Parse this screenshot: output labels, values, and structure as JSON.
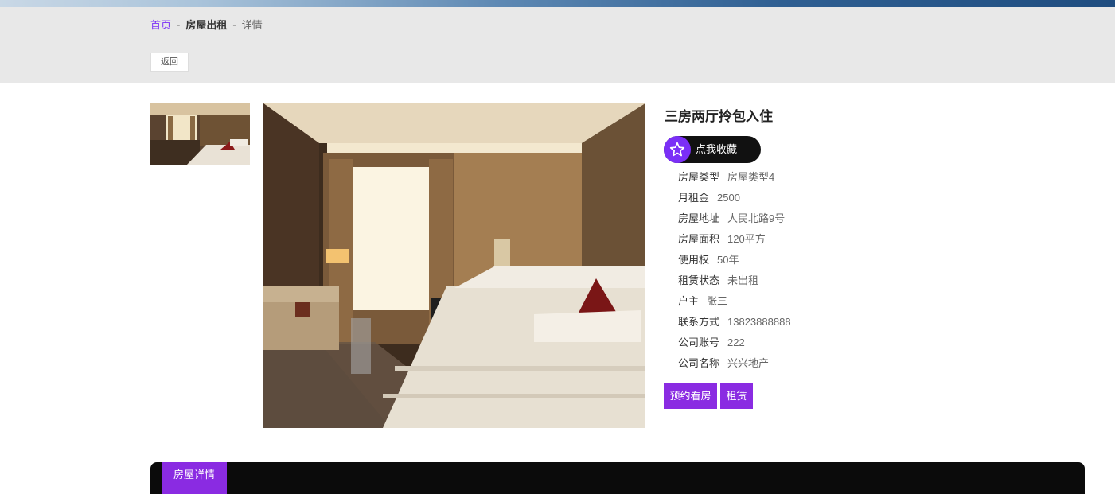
{
  "breadcrumb": {
    "home": "首页",
    "separator": "-",
    "section": "房屋出租",
    "current": "详情"
  },
  "back_button": "返回",
  "listing": {
    "title": "三房两厅拎包入住",
    "favorite_label": "点我收藏",
    "details": [
      {
        "label": "房屋类型",
        "value": "房屋类型4"
      },
      {
        "label": "月租金",
        "value": "2500"
      },
      {
        "label": "房屋地址",
        "value": "人民北路9号"
      },
      {
        "label": "房屋面积",
        "value": "120平方"
      },
      {
        "label": "使用权",
        "value": "50年"
      },
      {
        "label": "租赁状态",
        "value": "未出租"
      },
      {
        "label": "户主",
        "value": "张三"
      },
      {
        "label": "联系方式",
        "value": "13823888888"
      },
      {
        "label": "公司账号",
        "value": "222"
      },
      {
        "label": "公司名称",
        "value": "兴兴地产"
      }
    ],
    "actions": {
      "book_viewing": "预约看房",
      "rent": "租赁"
    }
  },
  "detail_tab": "房屋详情",
  "colors": {
    "accent": "#8a2be2",
    "breadcrumb_bg": "#e8e8e8",
    "dark_bar": "#0b0b0b"
  },
  "icons": {
    "favorite": "star-outline-icon"
  }
}
